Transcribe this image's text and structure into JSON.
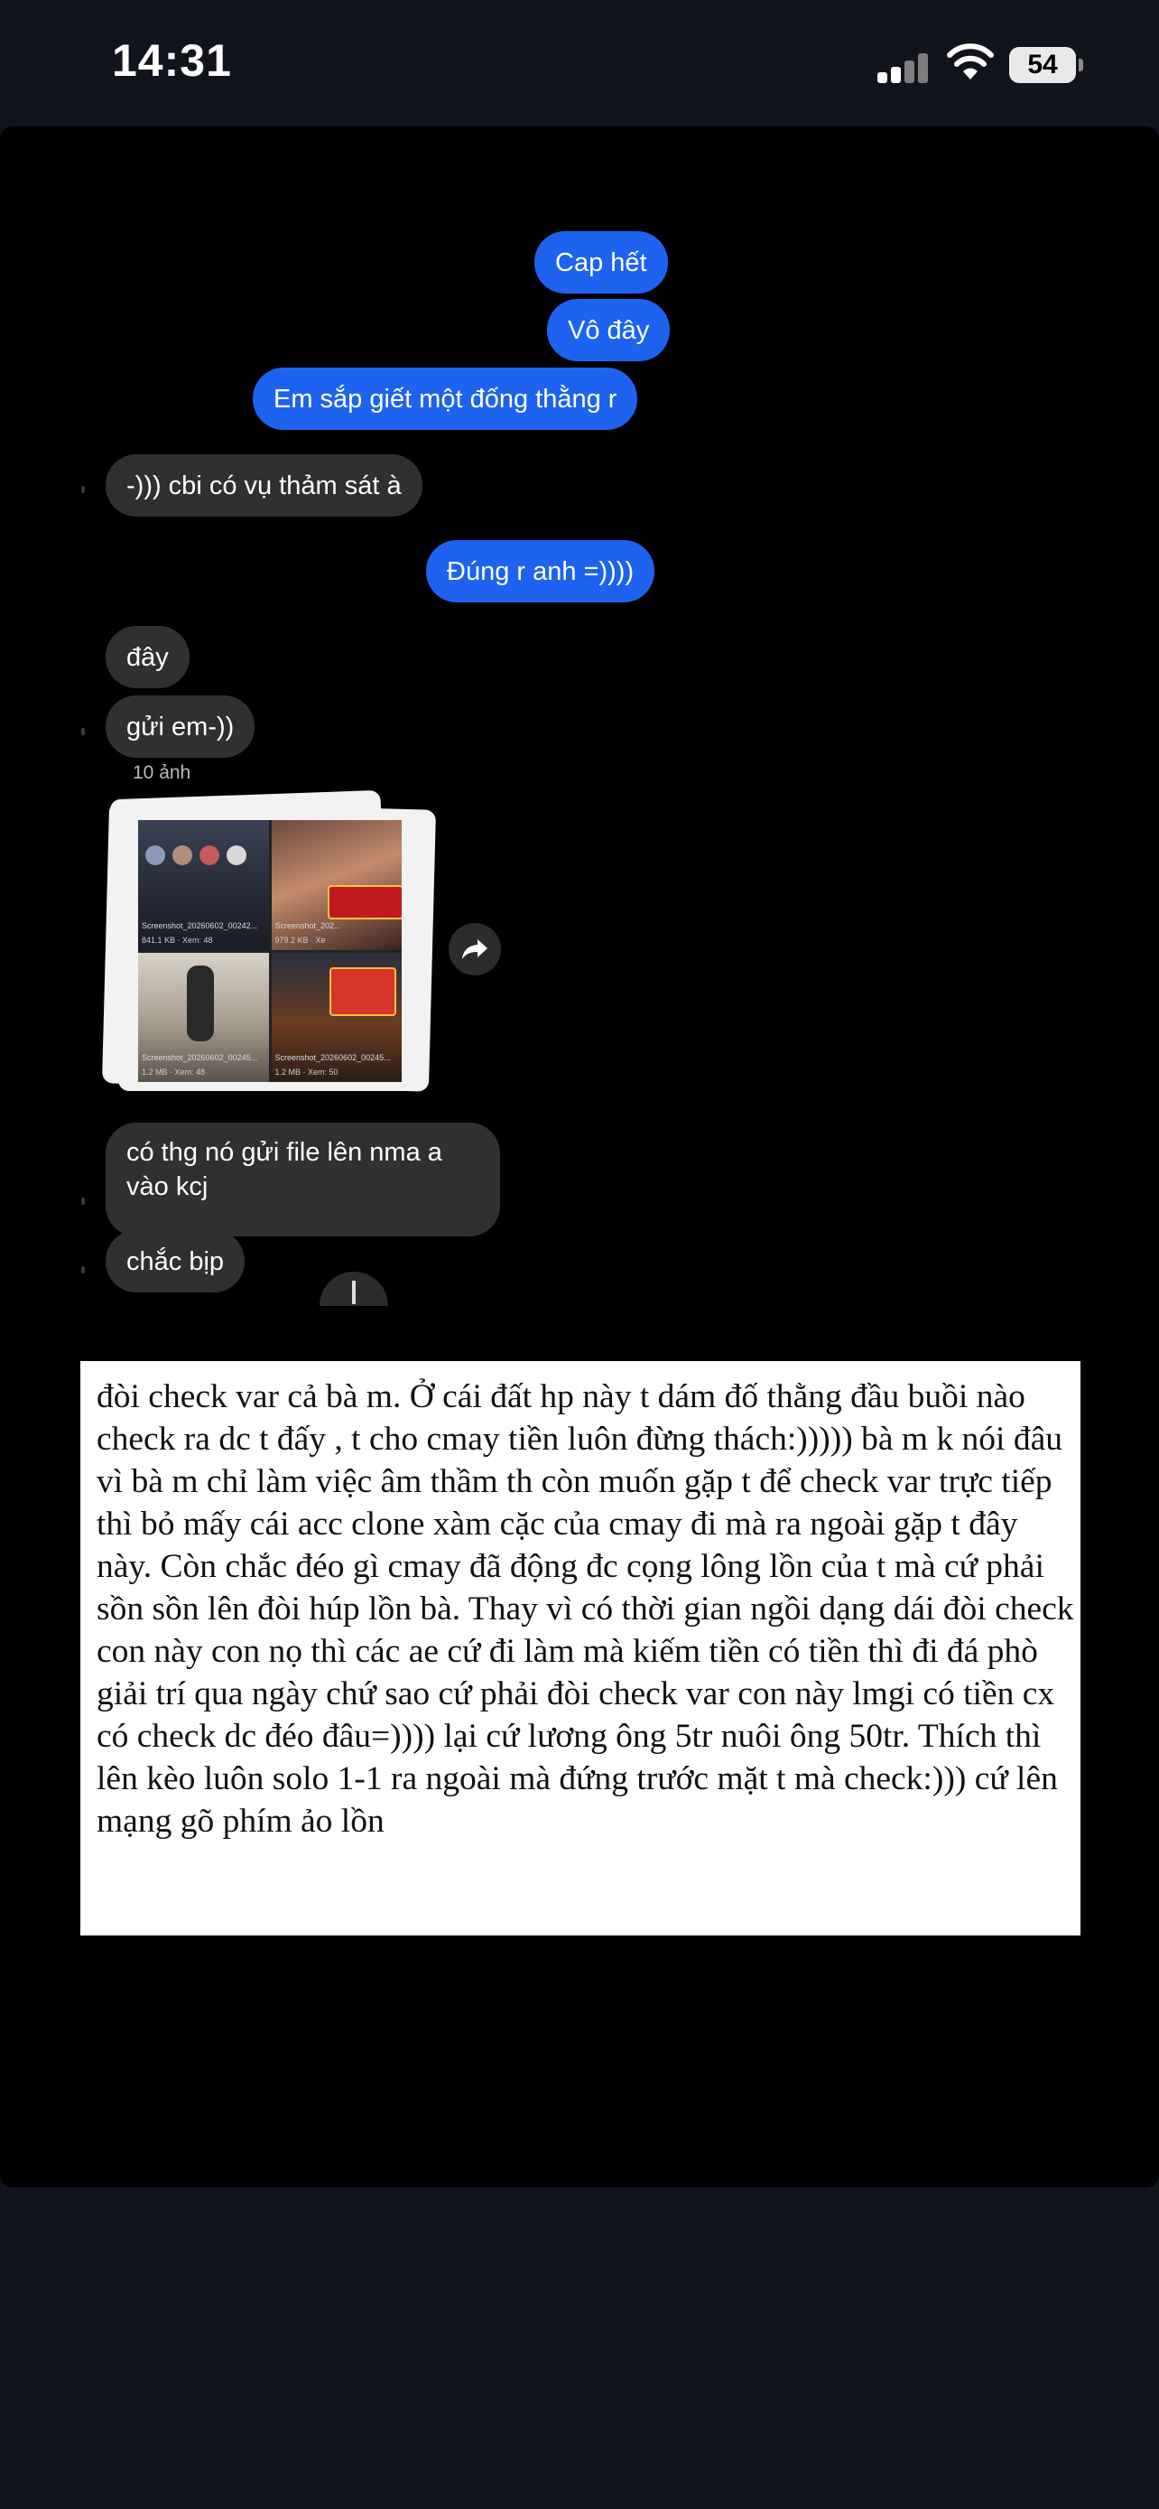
{
  "status_bar": {
    "time": "14:31",
    "battery": "54"
  },
  "chat": {
    "messages": [
      {
        "id": "m1",
        "side": "sent",
        "text": "Cap hết"
      },
      {
        "id": "m2",
        "side": "sent",
        "text": "Vô đây"
      },
      {
        "id": "m3",
        "side": "sent",
        "text": "Em sắp giết một đống thằng r"
      },
      {
        "id": "m4",
        "side": "received",
        "text": "-))) cbi có vụ thảm sát à"
      },
      {
        "id": "m5",
        "side": "sent",
        "text": "Đúng r anh =))))"
      },
      {
        "id": "m6",
        "side": "received",
        "text": "đây"
      },
      {
        "id": "m7",
        "side": "received",
        "text": "gửi em-))"
      },
      {
        "id": "m8",
        "side": "received",
        "text": "có thg nó gửi file lên nma a vào kcj"
      },
      {
        "id": "m9",
        "side": "received",
        "text": "chắc bịp"
      }
    ],
    "attachment": {
      "count_label": "10 ảnh",
      "thumbnails": [
        {
          "caption": "Screenshot_20260602_00242...",
          "size": "841.1 KB · Xem: 48"
        },
        {
          "caption": "Screenshot_202...",
          "size": "979.2 KB · Xe"
        },
        {
          "caption": "Screenshot_20260602_00245...",
          "size": "1.2 MB · Xem: 48"
        },
        {
          "caption": "Screenshot_20260602_00245...",
          "size": "1.2 MB · Xem: 50"
        }
      ]
    }
  },
  "text_card": {
    "body": "đòi check var cả bà m. Ở cái đất hp này t dám đố thằng đầu buồi nào check ra dc t đấy , t cho cmay tiền luôn đừng thách:))))) bà m k nói đâu vì bà m chỉ làm việc âm thầm th còn muốn gặp t để check var trực tiếp thì bỏ mấy cái acc clone xàm cặc của cmay đi mà ra ngoài gặp t đây này. Còn chắc đéo gì cmay đã động đc cọng lông lồn của t mà cứ phải sồn sồn lên đòi húp lồn bà. Thay vì có thời gian ngồi dạng dái đòi check con này con nọ thì các ae cứ đi làm mà kiếm tiền có tiền thì đi đá phò giải trí qua ngày chứ sao cứ phải đòi check var con này lmgi có tiền cx có check dc đéo đâu=)))) lại cứ lương ông 5tr nuôi ông 50tr. Thích thì lên kèo luôn solo 1-1 ra ngoài mà đứng trước mặt t mà check:))) cứ lên mạng gõ phím ảo lồn"
  },
  "colors": {
    "sent_bubble": "#1d63f0",
    "received_bubble": "#303033",
    "panel_background": "#000000",
    "page_background": "#11141c"
  }
}
